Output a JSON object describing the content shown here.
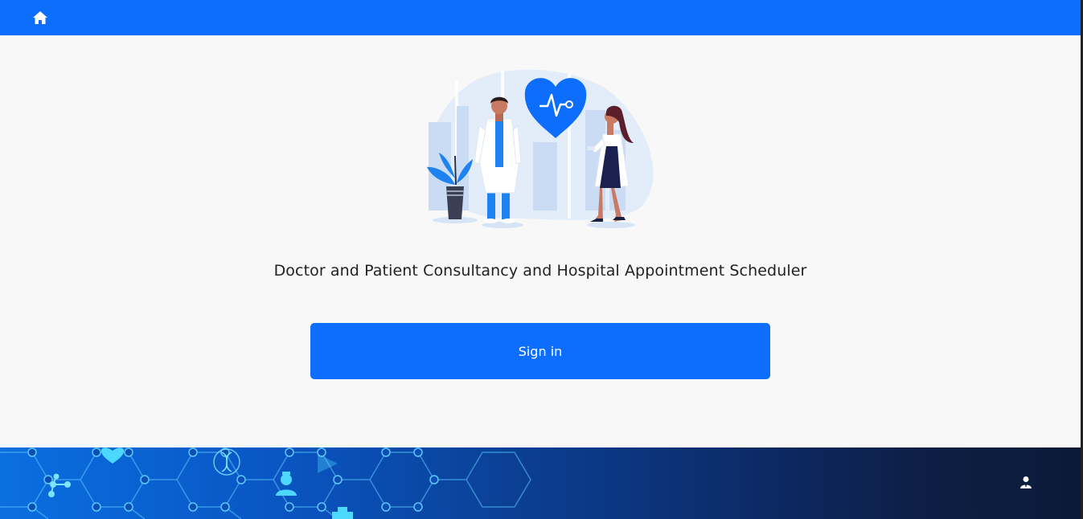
{
  "header": {
    "home_icon": "home-icon",
    "accent_color": "#0d6efd"
  },
  "main": {
    "illustration": "doctors-heart-illustration",
    "title": "Doctor and Patient Consultancy and Hospital Appointment Scheduler",
    "signin_label": "Sign in"
  },
  "footer": {
    "background_art": "medical-hexagon-network",
    "user_icon": "user-icon"
  }
}
